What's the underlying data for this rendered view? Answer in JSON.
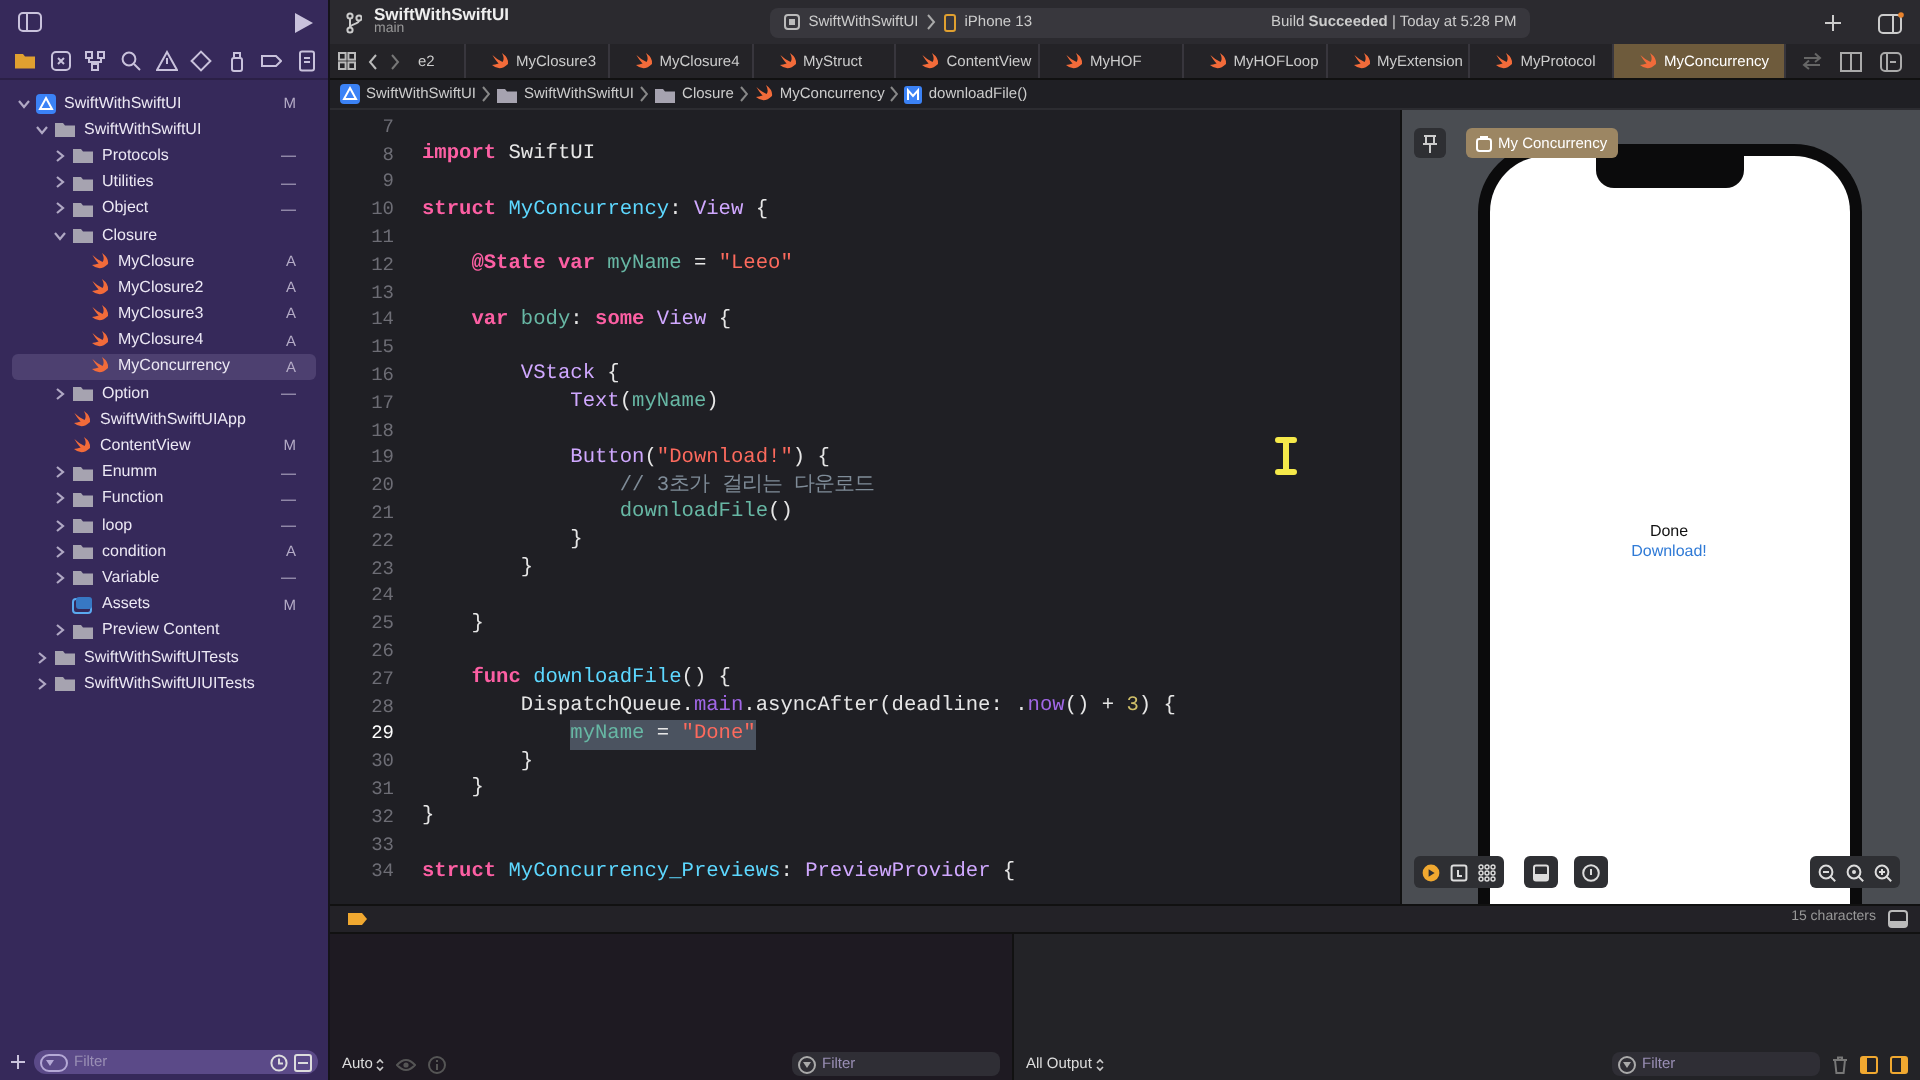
{
  "toolbar": {
    "project": "SwiftWithSwiftUI",
    "branch": "main",
    "scheme": "SwiftWithSwiftUI",
    "device": "iPhone 13",
    "status": "Build **Succeeded** | Today at 5:28 PM"
  },
  "navigator": {
    "tree": [
      {
        "name": "SwiftWithSwiftUI",
        "kind": "project",
        "badge": "M",
        "expanded": true,
        "selected": false,
        "children": [
          {
            "name": "SwiftWithSwiftUI",
            "kind": "folder",
            "expanded": true,
            "selected": false,
            "children": [
              {
                "name": "Protocols",
                "kind": "folder",
                "badge": "—",
                "expanded": false,
                "selected": false
              },
              {
                "name": "Utilities",
                "kind": "folder",
                "badge": "—",
                "expanded": false,
                "selected": false
              },
              {
                "name": "Object",
                "kind": "folder",
                "badge": "—",
                "expanded": false,
                "selected": false
              },
              {
                "name": "Closure",
                "kind": "folder",
                "expanded": true,
                "selected": false,
                "children": [
                  {
                    "name": "MyClosure",
                    "kind": "swift",
                    "badge": "A",
                    "selected": false
                  },
                  {
                    "name": "MyClosure2",
                    "kind": "swift",
                    "badge": "A",
                    "selected": false
                  },
                  {
                    "name": "MyClosure3",
                    "kind": "swift",
                    "badge": "A",
                    "selected": false
                  },
                  {
                    "name": "MyClosure4",
                    "kind": "swift",
                    "badge": "A",
                    "selected": false
                  },
                  {
                    "name": "MyConcurrency",
                    "kind": "swift",
                    "badge": "A",
                    "selected": true
                  }
                ]
              },
              {
                "name": "Option",
                "kind": "folder",
                "badge": "—",
                "expanded": false,
                "selected": false
              },
              {
                "name": "SwiftWithSwiftUIApp",
                "kind": "swift",
                "selected": false
              },
              {
                "name": "ContentView",
                "kind": "swift",
                "badge": "M",
                "selected": false
              },
              {
                "name": "Enumm",
                "kind": "folder",
                "badge": "—",
                "expanded": false,
                "selected": false
              },
              {
                "name": "Function",
                "kind": "folder",
                "badge": "—",
                "expanded": false,
                "selected": false
              },
              {
                "name": "loop",
                "kind": "folder",
                "badge": "—",
                "expanded": false,
                "selected": false
              },
              {
                "name": "condition",
                "kind": "folder",
                "badge": "A",
                "expanded": false,
                "selected": false
              },
              {
                "name": "Variable",
                "kind": "folder",
                "badge": "—",
                "expanded": false,
                "selected": false
              },
              {
                "name": "Assets",
                "kind": "assets",
                "badge": "M",
                "selected": false
              },
              {
                "name": "Preview Content",
                "kind": "folder",
                "expanded": false,
                "selected": false
              }
            ]
          },
          {
            "name": "SwiftWithSwiftUITests",
            "kind": "folder",
            "expanded": false,
            "selected": false
          },
          {
            "name": "SwiftWithSwiftUIUITests",
            "kind": "folder",
            "expanded": false,
            "selected": false
          }
        ]
      }
    ],
    "filter": {
      "placeholder": "Filter"
    }
  },
  "tabs": [
    {
      "label": "e2",
      "clipped": true,
      "selected": false
    },
    {
      "label": "MyClosure3",
      "clipped": false,
      "selected": false
    },
    {
      "label": "MyClosure4",
      "clipped": false,
      "selected": false
    },
    {
      "label": "MyStruct",
      "clipped": false,
      "selected": false
    },
    {
      "label": "ContentView",
      "clipped": false,
      "selected": false
    },
    {
      "label": "MyHOF",
      "clipped": false,
      "selected": false
    },
    {
      "label": "MyHOFLoop",
      "clipped": false,
      "selected": false
    },
    {
      "label": "MyExtension",
      "clipped": false,
      "selected": false
    },
    {
      "label": "MyProtocol",
      "clipped": false,
      "selected": false
    },
    {
      "label": "MyConcurrency",
      "clipped": false,
      "selected": true
    }
  ],
  "breadcrumb": [
    {
      "label": "SwiftWithSwiftUI",
      "kind": "project"
    },
    {
      "label": "SwiftWithSwiftUI",
      "kind": "folder"
    },
    {
      "label": "Closure",
      "kind": "folder"
    },
    {
      "label": "MyConcurrency",
      "kind": "swift"
    },
    {
      "label": "downloadFile()",
      "kind": "method"
    }
  ],
  "editor": {
    "lines": [
      {
        "number": "7",
        "selected": false
      },
      {
        "number": "8",
        "selected": false,
        "tokens": [
          {
            "kind": "keyword",
            "text": "import"
          },
          {
            "kind": "plain",
            "text": " SwiftUI"
          }
        ]
      },
      {
        "number": "9",
        "selected": false
      },
      {
        "number": "10",
        "selected": false,
        "tokens": [
          {
            "kind": "keyword",
            "text": "struct"
          },
          {
            "kind": "decl",
            "text": " MyConcurrency"
          },
          {
            "kind": "plain",
            "text": ": "
          },
          {
            "kind": "type",
            "text": "View"
          },
          {
            "kind": "plain",
            "text": " {"
          }
        ]
      },
      {
        "number": "11",
        "selected": false
      },
      {
        "number": "12",
        "selected": false,
        "tokens": [
          {
            "kind": "keyword",
            "text": "    @State var"
          },
          {
            "kind": "ident",
            "text": " myName"
          },
          {
            "kind": "plain",
            "text": " = "
          },
          {
            "kind": "string",
            "text": "\"Leeo\""
          }
        ]
      },
      {
        "number": "13",
        "selected": false
      },
      {
        "number": "14",
        "selected": false,
        "tokens": [
          {
            "kind": "keyword",
            "text": "    var"
          },
          {
            "kind": "ident",
            "text": " body"
          },
          {
            "kind": "plain",
            "text": ": "
          },
          {
            "kind": "keyword",
            "text": "some"
          },
          {
            "kind": "type",
            "text": " View"
          },
          {
            "kind": "plain",
            "text": " {"
          }
        ]
      },
      {
        "number": "15",
        "selected": false
      },
      {
        "number": "16",
        "selected": false,
        "tokens": [
          {
            "kind": "type",
            "text": "        VStack"
          },
          {
            "kind": "plain",
            "text": " {"
          }
        ]
      },
      {
        "number": "17",
        "selected": false,
        "tokens": [
          {
            "kind": "type",
            "text": "            Text"
          },
          {
            "kind": "plain",
            "text": "("
          },
          {
            "kind": "ident",
            "text": "myName"
          },
          {
            "kind": "plain",
            "text": ")"
          }
        ]
      },
      {
        "number": "18",
        "selected": false
      },
      {
        "number": "19",
        "selected": false,
        "tokens": [
          {
            "kind": "type",
            "text": "            Button"
          },
          {
            "kind": "plain",
            "text": "("
          },
          {
            "kind": "string",
            "text": "\"Download!\""
          },
          {
            "kind": "plain",
            "text": ") {"
          }
        ]
      },
      {
        "number": "20",
        "selected": false,
        "tokens": [
          {
            "kind": "comment",
            "text": "                // 3초가 걸리는 다운로드"
          }
        ]
      },
      {
        "number": "21",
        "selected": false,
        "tokens": [
          {
            "kind": "ident",
            "text": "                downloadFile"
          },
          {
            "kind": "plain",
            "text": "()"
          }
        ]
      },
      {
        "number": "22",
        "selected": false,
        "tokens": [
          {
            "kind": "plain",
            "text": "            }"
          }
        ]
      },
      {
        "number": "23",
        "selected": false,
        "tokens": [
          {
            "kind": "plain",
            "text": "        }"
          }
        ]
      },
      {
        "number": "24",
        "selected": false
      },
      {
        "number": "25",
        "selected": false,
        "tokens": [
          {
            "kind": "plain",
            "text": "    }"
          }
        ]
      },
      {
        "number": "26",
        "selected": false
      },
      {
        "number": "27",
        "selected": false,
        "tokens": [
          {
            "kind": "keyword",
            "text": "    func"
          },
          {
            "kind": "decl",
            "text": " downloadFile"
          },
          {
            "kind": "plain",
            "text": "() {"
          }
        ]
      },
      {
        "number": "28",
        "selected": false,
        "tokens": [
          {
            "kind": "plain",
            "text": "        DispatchQueue."
          },
          {
            "kind": "member",
            "text": "main"
          },
          {
            "kind": "plain",
            "text": ".asyncAfter(deadline: ."
          },
          {
            "kind": "member",
            "text": "now"
          },
          {
            "kind": "plain",
            "text": "() + "
          },
          {
            "kind": "number",
            "text": "3"
          },
          {
            "kind": "plain",
            "text": ") {"
          }
        ]
      },
      {
        "number": "29",
        "selected": true,
        "tokens": [
          {
            "kind": "ident",
            "text": "            myName"
          },
          {
            "kind": "plain",
            "text": " = "
          },
          {
            "kind": "string",
            "text": "\"Done\""
          }
        ]
      },
      {
        "number": "30",
        "selected": false,
        "tokens": [
          {
            "kind": "plain",
            "text": "        }"
          }
        ]
      },
      {
        "number": "31",
        "selected": false,
        "tokens": [
          {
            "kind": "plain",
            "text": "    }"
          }
        ]
      },
      {
        "number": "32",
        "selected": false,
        "tokens": [
          {
            "kind": "plain",
            "text": "}"
          }
        ]
      },
      {
        "number": "33",
        "selected": false
      },
      {
        "number": "34",
        "selected": false,
        "tokens": [
          {
            "kind": "keyword",
            "text": "struct"
          },
          {
            "kind": "decl",
            "text": " MyConcurrency_Previews"
          },
          {
            "kind": "plain",
            "text": ": "
          },
          {
            "kind": "type",
            "text": "PreviewProvider"
          },
          {
            "kind": "plain",
            "text": " {"
          }
        ]
      }
    ],
    "status": "15 characters"
  },
  "preview": {
    "chip": "My Concurrency",
    "screen_text": "Done",
    "screen_button": "Download!"
  },
  "debug": {
    "mode": "Auto",
    "left_filter": {
      "placeholder": "Filter"
    },
    "output": "All Output",
    "right_filter": {
      "placeholder": "Filter"
    }
  }
}
